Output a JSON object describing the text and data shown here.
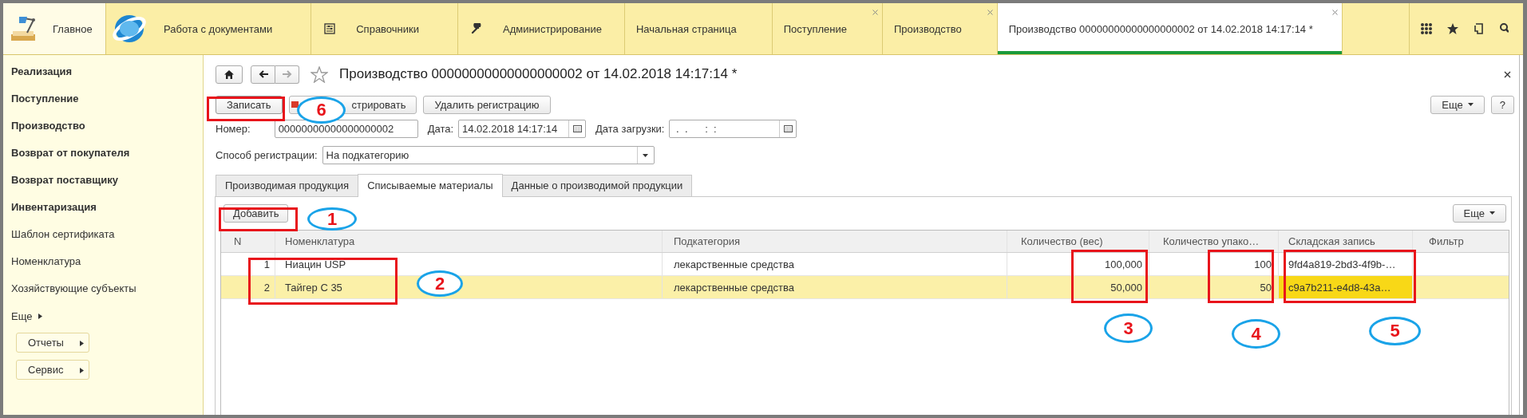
{
  "top_sections": [
    {
      "label": "Главное",
      "selected": true
    },
    {
      "label": "Работа с документами",
      "selected": false
    },
    {
      "label": "Справочники",
      "selected": false
    },
    {
      "label": "Администрирование",
      "selected": false
    }
  ],
  "open_tabs": [
    {
      "label": "Начальная страница",
      "selected": false,
      "closable": false
    },
    {
      "label": "Поступление",
      "selected": false,
      "closable": true
    },
    {
      "label": "Производство",
      "selected": false,
      "closable": true
    },
    {
      "label": "Производство 00000000000000000002 от 14.02.2018 14:17:14 *",
      "selected": true,
      "closable": true
    }
  ],
  "sidebar": {
    "items": [
      {
        "label": "Реализация",
        "bold": true
      },
      {
        "label": "Поступление",
        "bold": true
      },
      {
        "label": "Производство",
        "bold": true
      },
      {
        "label": "Возврат от покупателя",
        "bold": true
      },
      {
        "label": "Возврат поставщику",
        "bold": true
      },
      {
        "label": "Инвентаризация",
        "bold": true
      },
      {
        "label": "Шаблон сертификата",
        "bold": false
      },
      {
        "label": "Номенклатура",
        "bold": false
      },
      {
        "label": "Хозяйствующие субъекты",
        "bold": false
      }
    ],
    "more": "Еще",
    "buttons": [
      "Отчеты",
      "Сервис"
    ]
  },
  "form": {
    "title": "Производство 00000000000000000002 от 14.02.2018 14:17:14 *",
    "toolbar": {
      "buttons": [
        {
          "label": "Записать",
          "kind": "default"
        },
        {
          "label": "стрировать",
          "kind": "icon"
        },
        {
          "label": "Удалить регистрацию",
          "kind": "plain"
        }
      ],
      "more": "Еще",
      "help": "?"
    },
    "number": {
      "label": "Номер:",
      "value": "00000000000000000002"
    },
    "date": {
      "label": "Дата:",
      "value": "14.02.2018 14:17:14"
    },
    "load_date": {
      "label": "Дата загрузки:",
      "value": " .  .      :  :"
    },
    "method": {
      "label": "Способ регистрации:",
      "value": "На подкатегорию"
    },
    "tabs": [
      {
        "label": "Производимая продукция",
        "selected": false
      },
      {
        "label": "Списываемые материалы",
        "selected": true
      },
      {
        "label": "Данные о производимой продукции",
        "selected": false
      }
    ],
    "table": {
      "add_button": "Добавить",
      "more": "Еще",
      "columns": [
        "N",
        "Номенклатура",
        "Подкатегория",
        "Количество (вес)",
        "Количество упако…",
        "Складская запись",
        "Фильтр"
      ],
      "rows": [
        {
          "n": "1",
          "nomenclature": "Ниацин USP",
          "subcategory": "лекарственные средства",
          "qty_weight": "100,000",
          "qty_pack": "100",
          "stock_record": "9fd4a819-2bd3-4f9b-…",
          "selected": false,
          "stock_record_focused": false
        },
        {
          "n": "2",
          "nomenclature": "Тайгер С 35",
          "subcategory": "лекарственные средства",
          "qty_weight": "50,000",
          "qty_pack": "50",
          "stock_record": "c9a7b211-e4d8-43a…",
          "selected": true,
          "stock_record_focused": true
        }
      ]
    }
  },
  "annotations": [
    {
      "kind": "frame"
    },
    {
      "kind": "callout",
      "label": "6"
    },
    {
      "kind": "frame"
    },
    {
      "kind": "callout",
      "label": "1"
    },
    {
      "kind": "frame"
    },
    {
      "kind": "callout",
      "label": "2"
    },
    {
      "kind": "frame"
    },
    {
      "kind": "frame"
    },
    {
      "kind": "frame"
    },
    {
      "kind": "callout",
      "label": "3"
    },
    {
      "kind": "callout",
      "label": "4"
    },
    {
      "kind": "callout",
      "label": "5"
    }
  ]
}
